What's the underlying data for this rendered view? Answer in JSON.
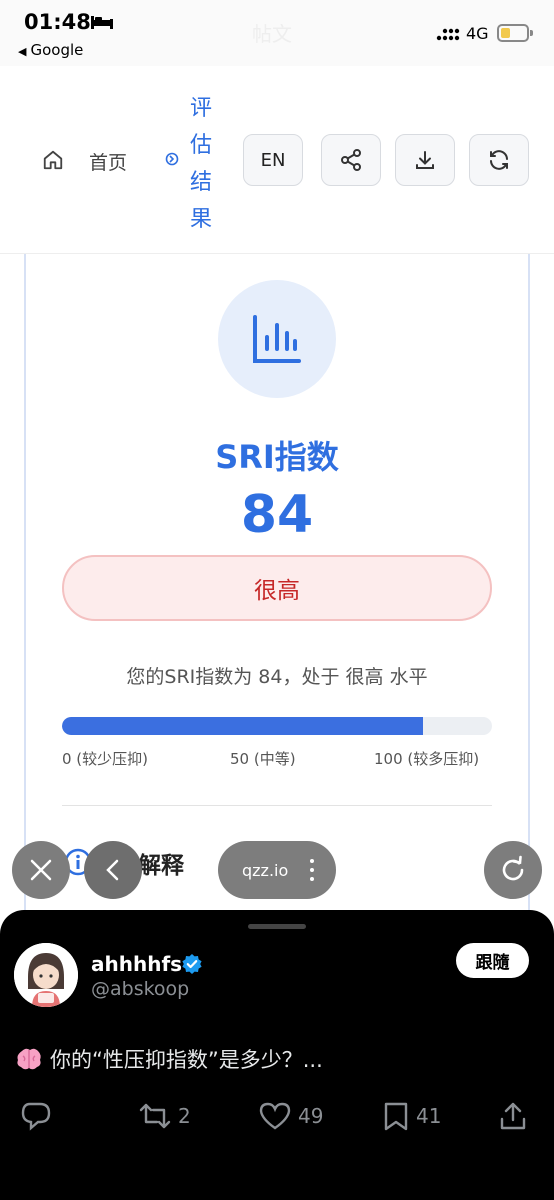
{
  "status_bar": {
    "time": "01:48",
    "back_app": "Google",
    "ghost_title": "帖文",
    "network": "4G"
  },
  "nav": {
    "home_label": "首页",
    "result_label": "评估结果",
    "lang_button": "EN",
    "icons": [
      "home-icon",
      "result-icon",
      "share-icon",
      "download-icon",
      "refresh-icon"
    ]
  },
  "result": {
    "title": "SRI指数",
    "score": "84",
    "level": "很高",
    "summary": "您的SRI指数为 84，处于 很高 水平",
    "progress_fraction": 0.84,
    "scale_min": "0 (较少压抑)",
    "scale_mid": "50 (中等)",
    "scale_max": "100 (较多压抑)",
    "section_title": "结果解释"
  },
  "overlay": {
    "url": "qzz.io"
  },
  "tweet": {
    "display_name": "ahhhhfs",
    "handle": "@abskoop",
    "follow_label": "跟隨",
    "text": "你的“性压抑指数”是多少？...",
    "retweets": "2",
    "likes": "49",
    "bookmarks": "41"
  },
  "colors": {
    "accent": "#2f6fe0",
    "level_red": "#c62828",
    "level_bg": "#fdecec",
    "progress": "#3b6fe0",
    "panel_bg": "#000000"
  }
}
